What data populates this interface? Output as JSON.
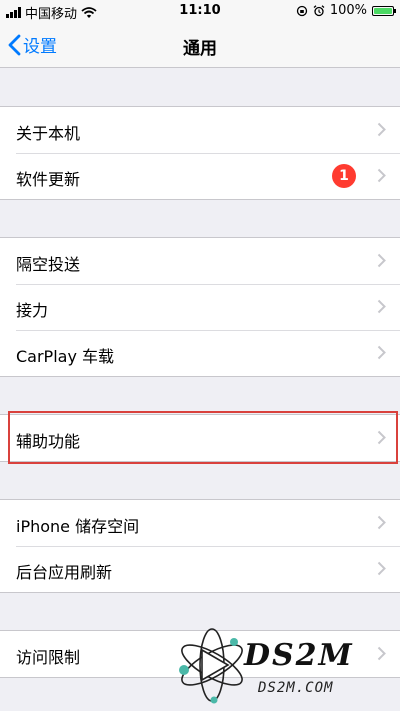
{
  "status_bar": {
    "carrier": "中国移动",
    "time": "11:10",
    "battery": "100%",
    "battery_level": 100,
    "battery_color": "#4cd964"
  },
  "nav": {
    "back_label": "设置",
    "title": "通用",
    "accent_color": "#007aff"
  },
  "groups": [
    {
      "items": [
        {
          "label": "关于本机"
        },
        {
          "label": "软件更新",
          "badge": "1"
        }
      ]
    },
    {
      "items": [
        {
          "label": "隔空投送"
        },
        {
          "label": "接力"
        },
        {
          "label": "CarPlay 车载"
        }
      ]
    },
    {
      "items": [
        {
          "label": "辅助功能"
        }
      ]
    },
    {
      "items": [
        {
          "label": "iPhone 储存空间"
        },
        {
          "label": "后台应用刷新"
        }
      ]
    },
    {
      "items": [
        {
          "label": "访问限制"
        }
      ]
    }
  ],
  "watermark": {
    "logo_text": "DS2M",
    "url_text": "DS2M.COM"
  },
  "icons": [
    "wifi-icon",
    "orientation-lock-icon",
    "alarm-icon",
    "battery-icon",
    "chevron-left-icon",
    "chevron-right-icon"
  ]
}
